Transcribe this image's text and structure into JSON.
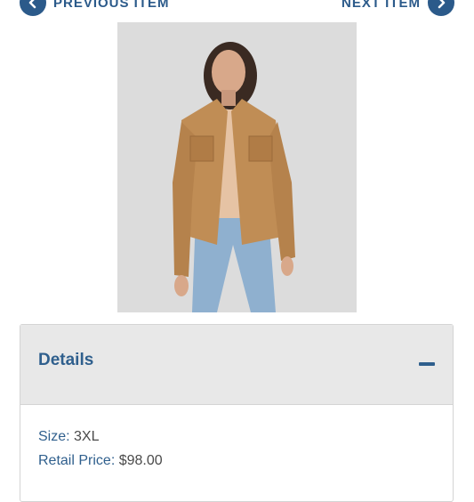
{
  "nav": {
    "prev_label": "PREVIOUS ITEM",
    "next_label": "NEXT ITEM"
  },
  "product": {
    "image_alt": "Woman wearing tan corduroy jacket with jeans"
  },
  "details": {
    "title": "Details",
    "size_label": "Size",
    "size_value": "3XL",
    "price_label": "Retail Price",
    "price_value": "$98.00"
  }
}
